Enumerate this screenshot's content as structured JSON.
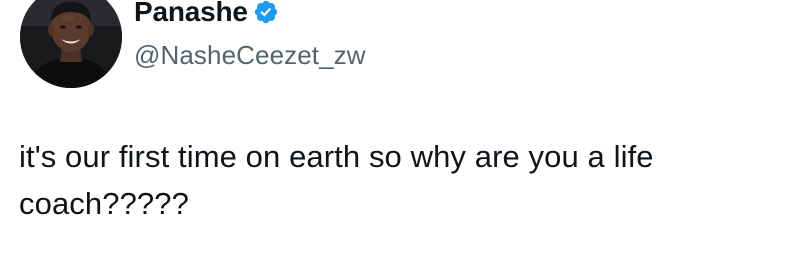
{
  "tweet": {
    "author": {
      "display_name": "Panashe",
      "handle": "@NasheCeezet_zw",
      "verified": true,
      "verified_color": "#1d9bf0",
      "avatar_icon": "profile-photo"
    },
    "text": "it's our first time on earth so why are you a life coach?????"
  }
}
